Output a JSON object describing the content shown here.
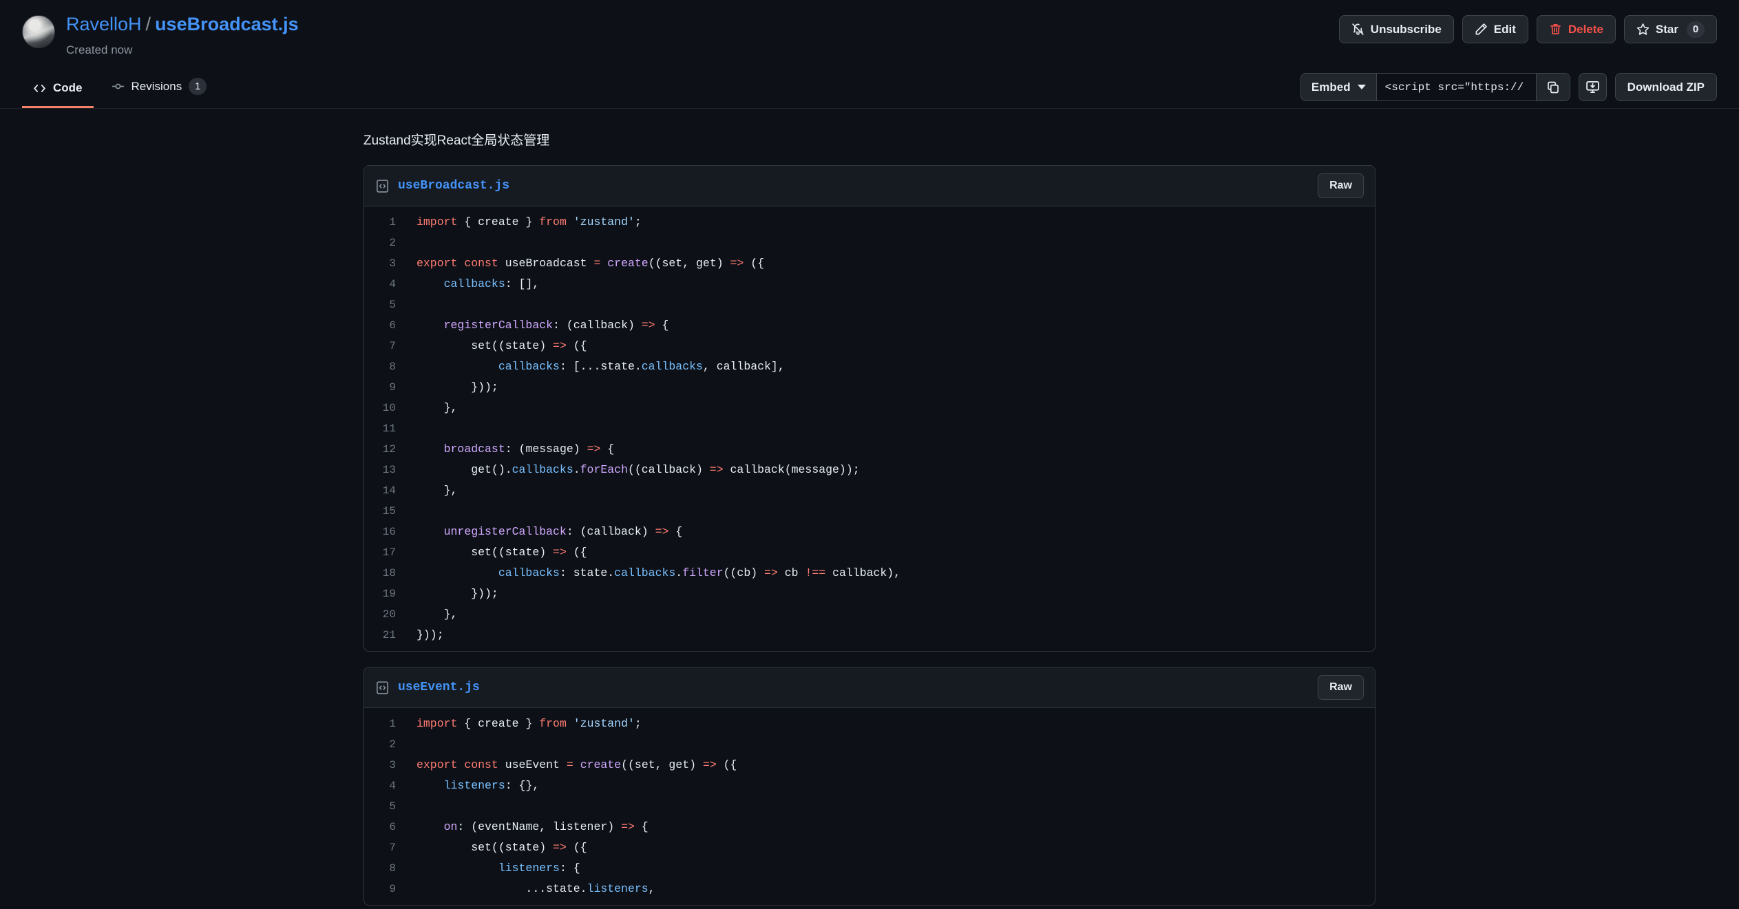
{
  "header": {
    "owner": "RavelloH",
    "separator": "/",
    "filename": "useBroadcast.js",
    "created": "Created now",
    "avatar_alt": "user-avatar"
  },
  "actions": [
    {
      "id": "unsubscribe",
      "label": "Unsubscribe",
      "icon": "bell-slash-icon"
    },
    {
      "id": "edit",
      "label": "Edit",
      "icon": "pencil-icon"
    },
    {
      "id": "delete",
      "label": "Delete",
      "icon": "trash-icon",
      "danger": true
    },
    {
      "id": "star",
      "label": "Star",
      "icon": "star-icon",
      "count": "0"
    }
  ],
  "tabs": [
    {
      "id": "code",
      "label": "Code",
      "icon": "code-icon",
      "active": true
    },
    {
      "id": "revisions",
      "label": "Revisions",
      "icon": "git-commit-icon",
      "count": "1",
      "active": false
    }
  ],
  "embed": {
    "select_label": "Embed",
    "value": "<script src=\"https://",
    "copy_icon": "copy-icon",
    "desktop_download_icon": "desktop-download-icon",
    "download_label": "Download ZIP"
  },
  "gist": {
    "description": "Zustand实现React全局状态管理"
  },
  "files": [
    {
      "name": "useBroadcast.js",
      "file_icon": "code-file-icon",
      "raw_label": "Raw",
      "lines": [
        {
          "n": "1",
          "tokens": [
            {
              "t": "import",
              "c": "k"
            },
            {
              "t": " { create } ",
              "c": "n"
            },
            {
              "t": "from",
              "c": "k"
            },
            {
              "t": " ",
              "c": "n"
            },
            {
              "t": "'zustand'",
              "c": "s"
            },
            {
              "t": ";",
              "c": "n"
            }
          ]
        },
        {
          "n": "2",
          "tokens": []
        },
        {
          "n": "3",
          "tokens": [
            {
              "t": "export",
              "c": "k"
            },
            {
              "t": " ",
              "c": "n"
            },
            {
              "t": "const",
              "c": "k"
            },
            {
              "t": " useBroadcast ",
              "c": "n"
            },
            {
              "t": "=",
              "c": "o"
            },
            {
              "t": " ",
              "c": "n"
            },
            {
              "t": "create",
              "c": "f"
            },
            {
              "t": "((set, get) ",
              "c": "n"
            },
            {
              "t": "=>",
              "c": "o"
            },
            {
              "t": " ({",
              "c": "n"
            }
          ]
        },
        {
          "n": "4",
          "tokens": [
            {
              "t": "    ",
              "c": "n"
            },
            {
              "t": "callbacks",
              "c": "p"
            },
            {
              "t": ": [],",
              "c": "n"
            }
          ]
        },
        {
          "n": "5",
          "tokens": []
        },
        {
          "n": "6",
          "tokens": [
            {
              "t": "    ",
              "c": "n"
            },
            {
              "t": "registerCallback",
              "c": "f"
            },
            {
              "t": ": (callback) ",
              "c": "n"
            },
            {
              "t": "=>",
              "c": "o"
            },
            {
              "t": " {",
              "c": "n"
            }
          ]
        },
        {
          "n": "7",
          "tokens": [
            {
              "t": "        set((state) ",
              "c": "n"
            },
            {
              "t": "=>",
              "c": "o"
            },
            {
              "t": " ({",
              "c": "n"
            }
          ]
        },
        {
          "n": "8",
          "tokens": [
            {
              "t": "            ",
              "c": "n"
            },
            {
              "t": "callbacks",
              "c": "p"
            },
            {
              "t": ": [...state.",
              "c": "n"
            },
            {
              "t": "callbacks",
              "c": "p"
            },
            {
              "t": ", callback],",
              "c": "n"
            }
          ]
        },
        {
          "n": "9",
          "tokens": [
            {
              "t": "        }));",
              "c": "n"
            }
          ]
        },
        {
          "n": "10",
          "tokens": [
            {
              "t": "    },",
              "c": "n"
            }
          ]
        },
        {
          "n": "11",
          "tokens": []
        },
        {
          "n": "12",
          "tokens": [
            {
              "t": "    ",
              "c": "n"
            },
            {
              "t": "broadcast",
              "c": "f"
            },
            {
              "t": ": (message) ",
              "c": "n"
            },
            {
              "t": "=>",
              "c": "o"
            },
            {
              "t": " {",
              "c": "n"
            }
          ]
        },
        {
          "n": "13",
          "tokens": [
            {
              "t": "        get().",
              "c": "n"
            },
            {
              "t": "callbacks",
              "c": "p"
            },
            {
              "t": ".",
              "c": "n"
            },
            {
              "t": "forEach",
              "c": "f"
            },
            {
              "t": "((callback) ",
              "c": "n"
            },
            {
              "t": "=>",
              "c": "o"
            },
            {
              "t": " callback(message));",
              "c": "n"
            }
          ]
        },
        {
          "n": "14",
          "tokens": [
            {
              "t": "    },",
              "c": "n"
            }
          ]
        },
        {
          "n": "15",
          "tokens": []
        },
        {
          "n": "16",
          "tokens": [
            {
              "t": "    ",
              "c": "n"
            },
            {
              "t": "unregisterCallback",
              "c": "f"
            },
            {
              "t": ": (callback) ",
              "c": "n"
            },
            {
              "t": "=>",
              "c": "o"
            },
            {
              "t": " {",
              "c": "n"
            }
          ]
        },
        {
          "n": "17",
          "tokens": [
            {
              "t": "        set((state) ",
              "c": "n"
            },
            {
              "t": "=>",
              "c": "o"
            },
            {
              "t": " ({",
              "c": "n"
            }
          ]
        },
        {
          "n": "18",
          "tokens": [
            {
              "t": "            ",
              "c": "n"
            },
            {
              "t": "callbacks",
              "c": "p"
            },
            {
              "t": ": state.",
              "c": "n"
            },
            {
              "t": "callbacks",
              "c": "p"
            },
            {
              "t": ".",
              "c": "n"
            },
            {
              "t": "filter",
              "c": "f"
            },
            {
              "t": "((cb) ",
              "c": "n"
            },
            {
              "t": "=>",
              "c": "o"
            },
            {
              "t": " cb ",
              "c": "n"
            },
            {
              "t": "!==",
              "c": "o"
            },
            {
              "t": " callback),",
              "c": "n"
            }
          ]
        },
        {
          "n": "19",
          "tokens": [
            {
              "t": "        }));",
              "c": "n"
            }
          ]
        },
        {
          "n": "20",
          "tokens": [
            {
              "t": "    },",
              "c": "n"
            }
          ]
        },
        {
          "n": "21",
          "tokens": [
            {
              "t": "}));",
              "c": "n"
            }
          ]
        }
      ]
    },
    {
      "name": "useEvent.js",
      "file_icon": "code-file-icon",
      "raw_label": "Raw",
      "lines": [
        {
          "n": "1",
          "tokens": [
            {
              "t": "import",
              "c": "k"
            },
            {
              "t": " { create } ",
              "c": "n"
            },
            {
              "t": "from",
              "c": "k"
            },
            {
              "t": " ",
              "c": "n"
            },
            {
              "t": "'zustand'",
              "c": "s"
            },
            {
              "t": ";",
              "c": "n"
            }
          ]
        },
        {
          "n": "2",
          "tokens": []
        },
        {
          "n": "3",
          "tokens": [
            {
              "t": "export",
              "c": "k"
            },
            {
              "t": " ",
              "c": "n"
            },
            {
              "t": "const",
              "c": "k"
            },
            {
              "t": " useEvent ",
              "c": "n"
            },
            {
              "t": "=",
              "c": "o"
            },
            {
              "t": " ",
              "c": "n"
            },
            {
              "t": "create",
              "c": "f"
            },
            {
              "t": "((set, get) ",
              "c": "n"
            },
            {
              "t": "=>",
              "c": "o"
            },
            {
              "t": " ({",
              "c": "n"
            }
          ]
        },
        {
          "n": "4",
          "tokens": [
            {
              "t": "    ",
              "c": "n"
            },
            {
              "t": "listeners",
              "c": "p"
            },
            {
              "t": ": {},",
              "c": "n"
            }
          ]
        },
        {
          "n": "5",
          "tokens": []
        },
        {
          "n": "6",
          "tokens": [
            {
              "t": "    ",
              "c": "n"
            },
            {
              "t": "on",
              "c": "f"
            },
            {
              "t": ": (eventName, listener) ",
              "c": "n"
            },
            {
              "t": "=>",
              "c": "o"
            },
            {
              "t": " {",
              "c": "n"
            }
          ]
        },
        {
          "n": "7",
          "tokens": [
            {
              "t": "        set((state) ",
              "c": "n"
            },
            {
              "t": "=>",
              "c": "o"
            },
            {
              "t": " ({",
              "c": "n"
            }
          ]
        },
        {
          "n": "8",
          "tokens": [
            {
              "t": "            ",
              "c": "n"
            },
            {
              "t": "listeners",
              "c": "p"
            },
            {
              "t": ": {",
              "c": "n"
            }
          ]
        },
        {
          "n": "9",
          "tokens": [
            {
              "t": "                ...state.",
              "c": "n"
            },
            {
              "t": "listeners",
              "c": "p"
            },
            {
              "t": ",",
              "c": "n"
            }
          ]
        }
      ]
    }
  ]
}
